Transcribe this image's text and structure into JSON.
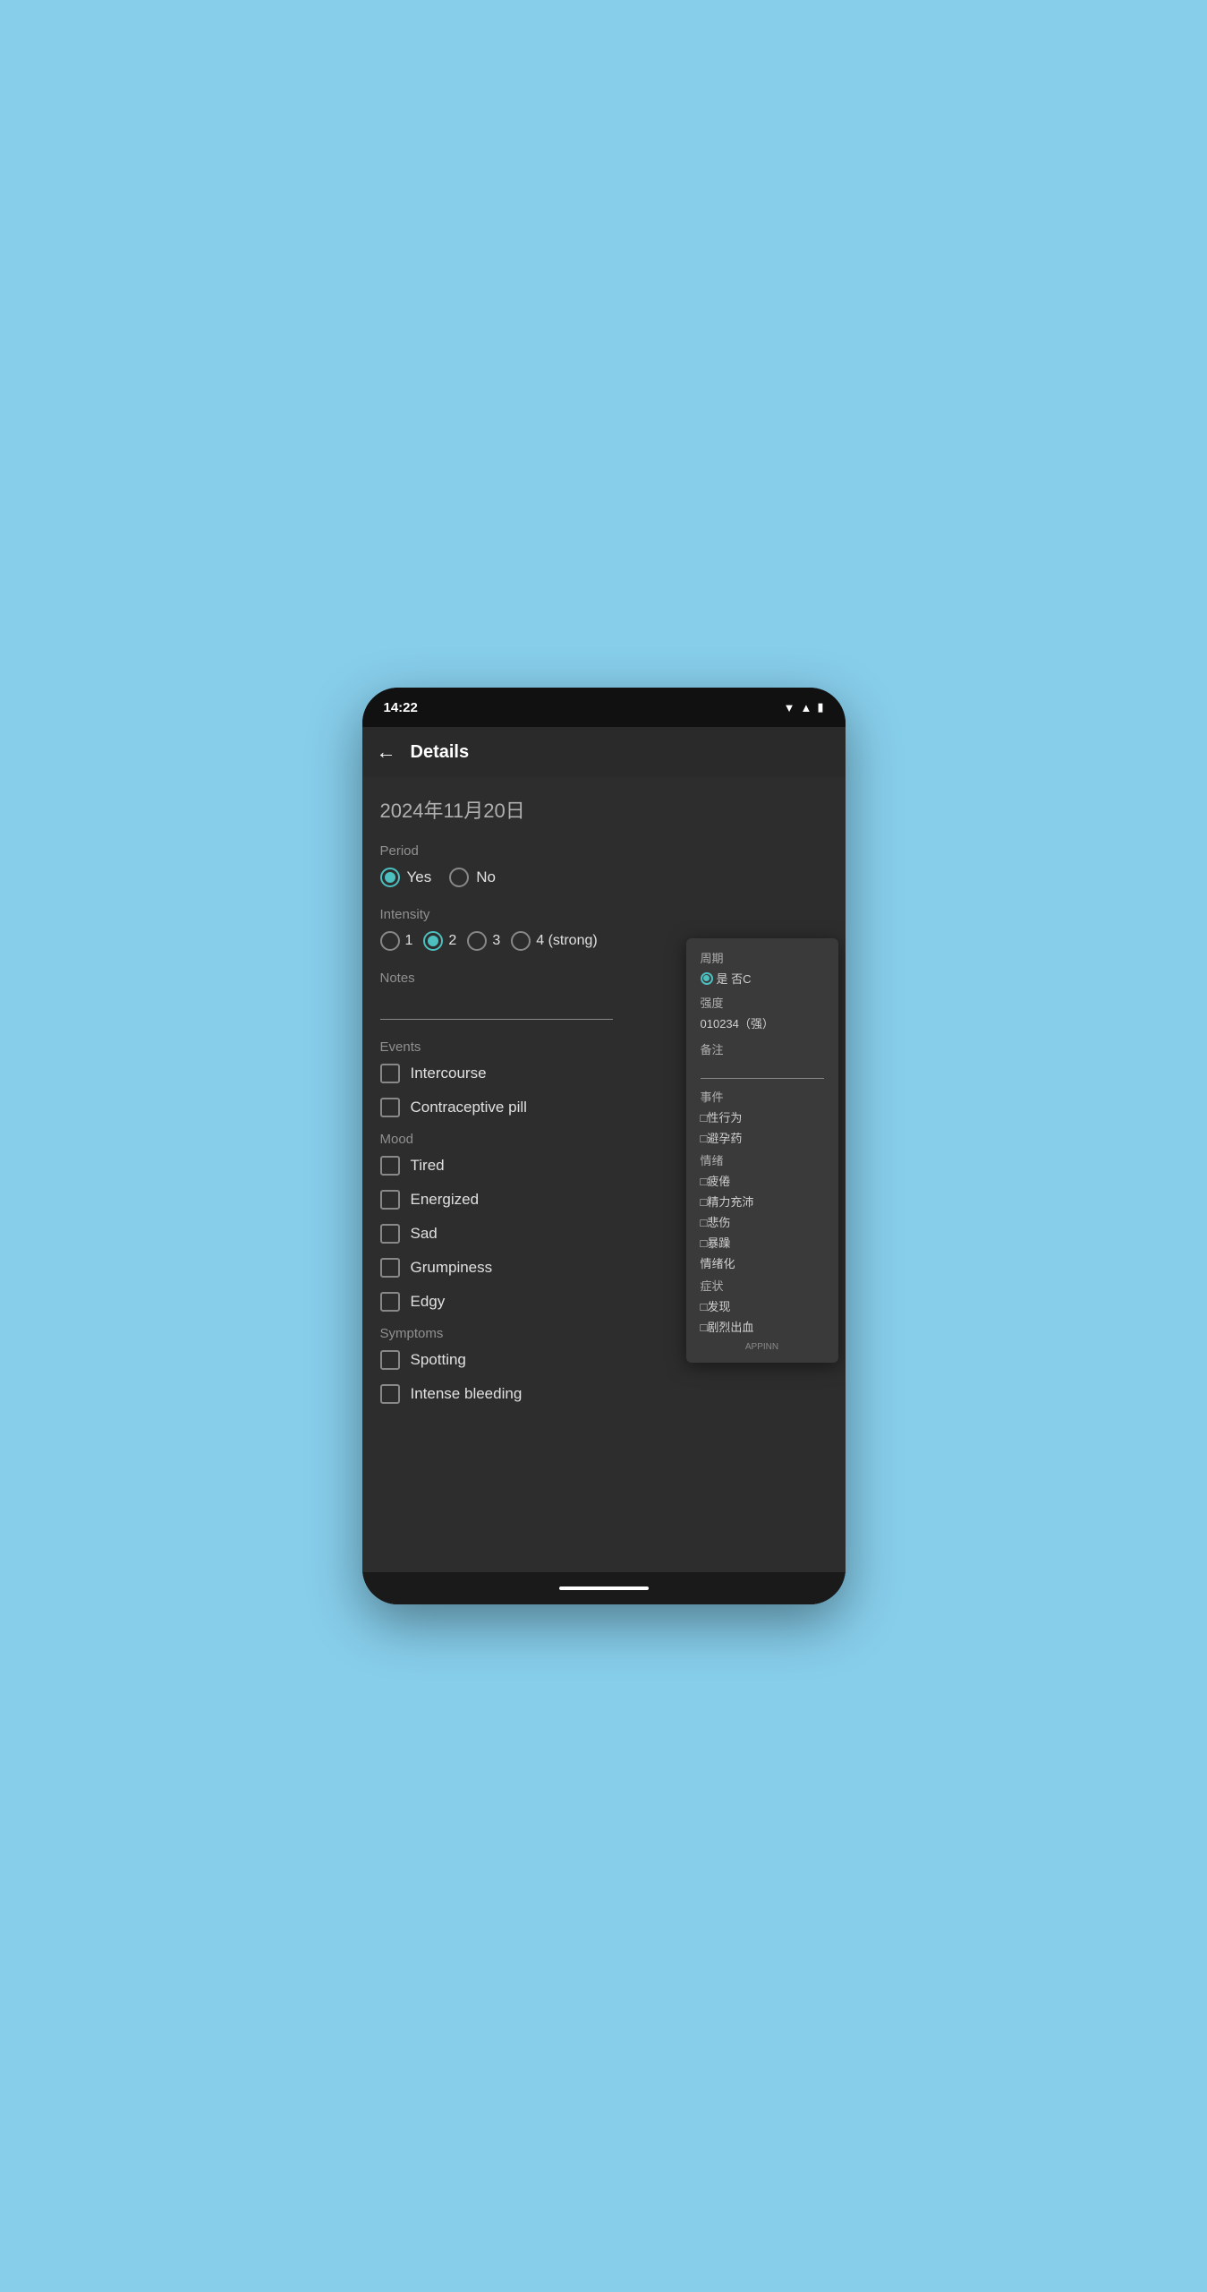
{
  "statusBar": {
    "time": "14:22"
  },
  "header": {
    "title": "Details",
    "backLabel": "←"
  },
  "main": {
    "date": "2024年11月20日",
    "period": {
      "label": "Period",
      "options": [
        {
          "label": "Yes",
          "selected": true
        },
        {
          "label": "No",
          "selected": false
        }
      ]
    },
    "intensity": {
      "label": "Intensity",
      "options": [
        {
          "label": "1",
          "selected": false
        },
        {
          "label": "2",
          "selected": true
        },
        {
          "label": "3",
          "selected": false
        },
        {
          "label": "4 (strong)",
          "selected": false
        }
      ]
    },
    "notes": {
      "label": "Notes"
    },
    "events": {
      "label": "Events",
      "items": [
        {
          "label": "Intercourse",
          "checked": false
        },
        {
          "label": "Contraceptive pill",
          "checked": false
        }
      ]
    },
    "mood": {
      "label": "Mood",
      "items": [
        {
          "label": "Tired",
          "checked": false
        },
        {
          "label": "Energized",
          "checked": false
        },
        {
          "label": "Sad",
          "checked": false
        },
        {
          "label": "Grumpiness",
          "checked": false
        },
        {
          "label": "Edgy",
          "checked": false
        }
      ]
    },
    "symptoms": {
      "label": "Symptoms",
      "items": [
        {
          "label": "Spotting",
          "checked": false
        },
        {
          "label": "Intense bleeding",
          "checked": false
        }
      ]
    }
  },
  "tooltip": {
    "period_label": "周期",
    "period_options": "●是 否C",
    "intensity_label": "强度",
    "intensity_options": "010234（强）",
    "notes_label": "备注",
    "events_label": "事件",
    "events_items": [
      "□性行为",
      "□避孕药"
    ],
    "mood_label": "情绪",
    "mood_items": [
      "□疲倦",
      "□精力充沛",
      "□悲伤",
      "□暴躁",
      "情绪化"
    ],
    "symptoms_label": "症状",
    "symptoms_items": [
      "□发现",
      "□剧烈出血"
    ],
    "footer": "APPINN"
  }
}
